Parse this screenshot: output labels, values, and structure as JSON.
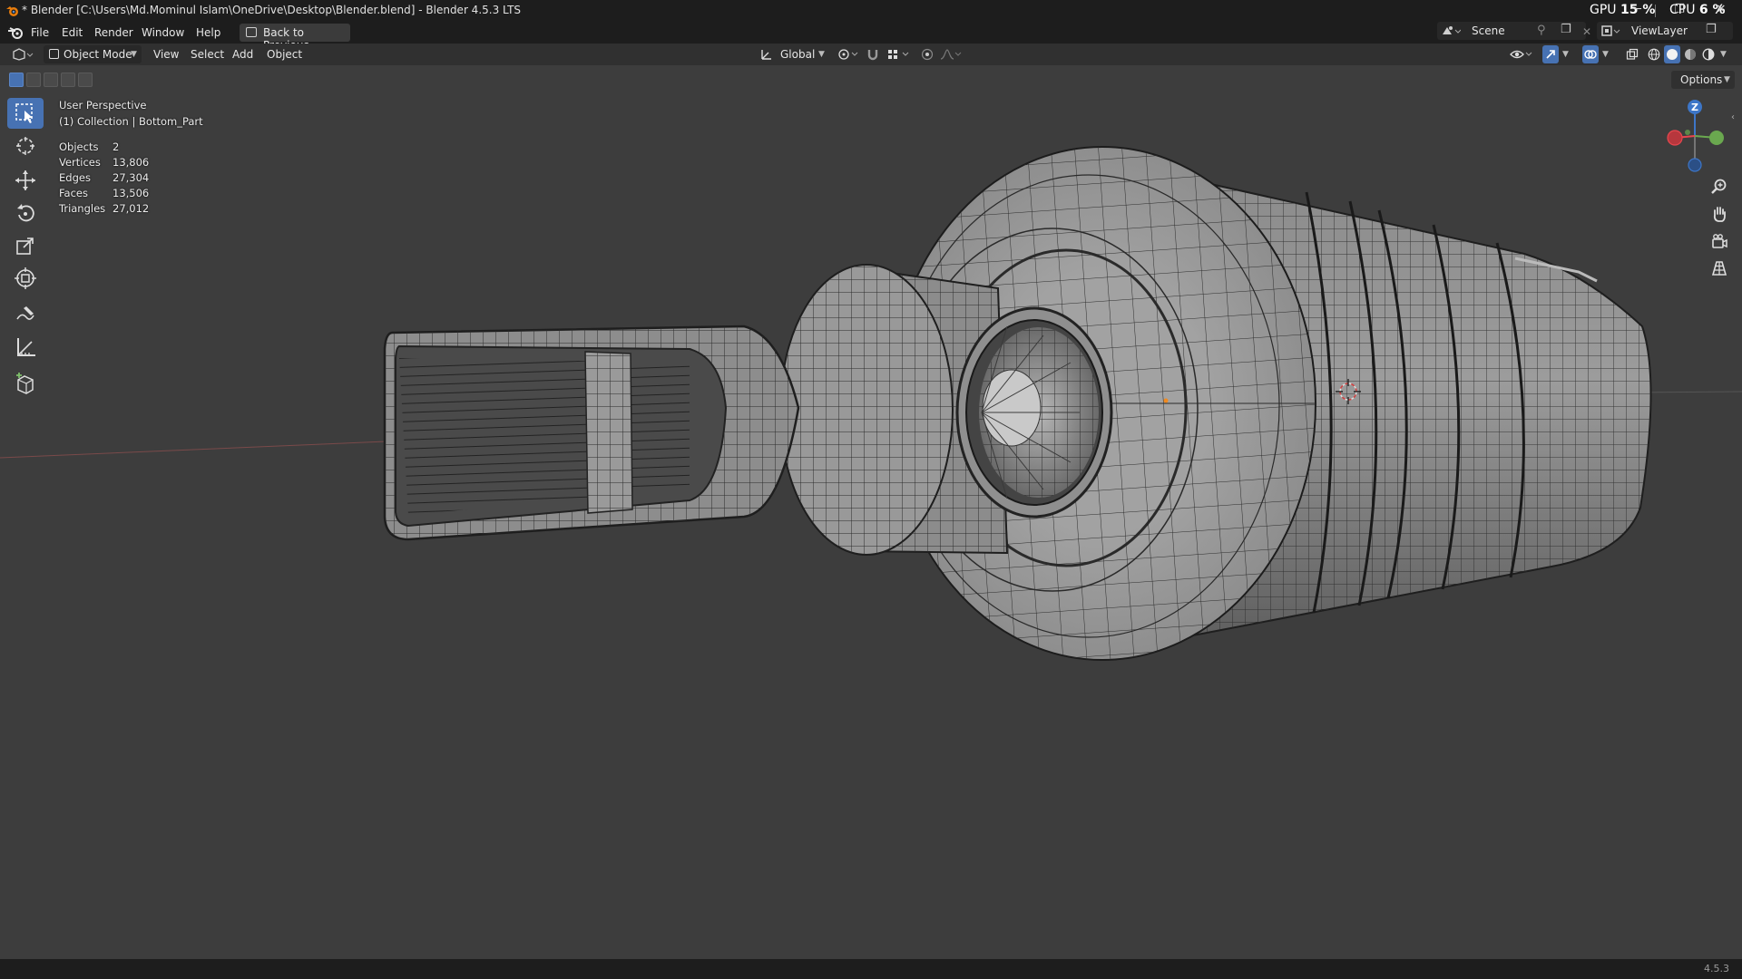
{
  "window": {
    "title": "* Blender [C:\\Users\\Md.Mominul Islam\\OneDrive\\Desktop\\Blender.blend] - Blender 4.5.3 LTS",
    "minimize": "─",
    "maximize": "❐",
    "close": "✕"
  },
  "perf": {
    "gpu_label": "GPU",
    "gpu_value": "15 %",
    "cpu_label": "CPU",
    "cpu_value": "6 %"
  },
  "menu": {
    "file": "File",
    "edit": "Edit",
    "render": "Render",
    "window": "Window",
    "help": "Help",
    "back_to_previous": "Back to Previous"
  },
  "scene": {
    "name": "Scene",
    "view_layer": "ViewLayer"
  },
  "header": {
    "mode": "Object Mode",
    "view": "View",
    "select": "Select",
    "add": "Add",
    "object": "Object",
    "transform_orientation": "Global",
    "options": "Options"
  },
  "viewport": {
    "perspective": "User Perspective",
    "collection": "(1) Collection | Bottom_Part",
    "stats": [
      {
        "label": "Objects",
        "value": "2"
      },
      {
        "label": "Vertices",
        "value": "13,806"
      },
      {
        "label": "Edges",
        "value": "27,304"
      },
      {
        "label": "Faces",
        "value": "13,506"
      },
      {
        "label": "Triangles",
        "value": "27,012"
      }
    ],
    "gizmo_z": "Z"
  },
  "status": {
    "version": "4.5.3"
  },
  "colors": {
    "accent": "#4772b3",
    "axis_x": "#e8464e",
    "axis_y": "#6aa84f",
    "axis_z": "#3d76c8",
    "viewport_bg": "#3d3d3d"
  }
}
